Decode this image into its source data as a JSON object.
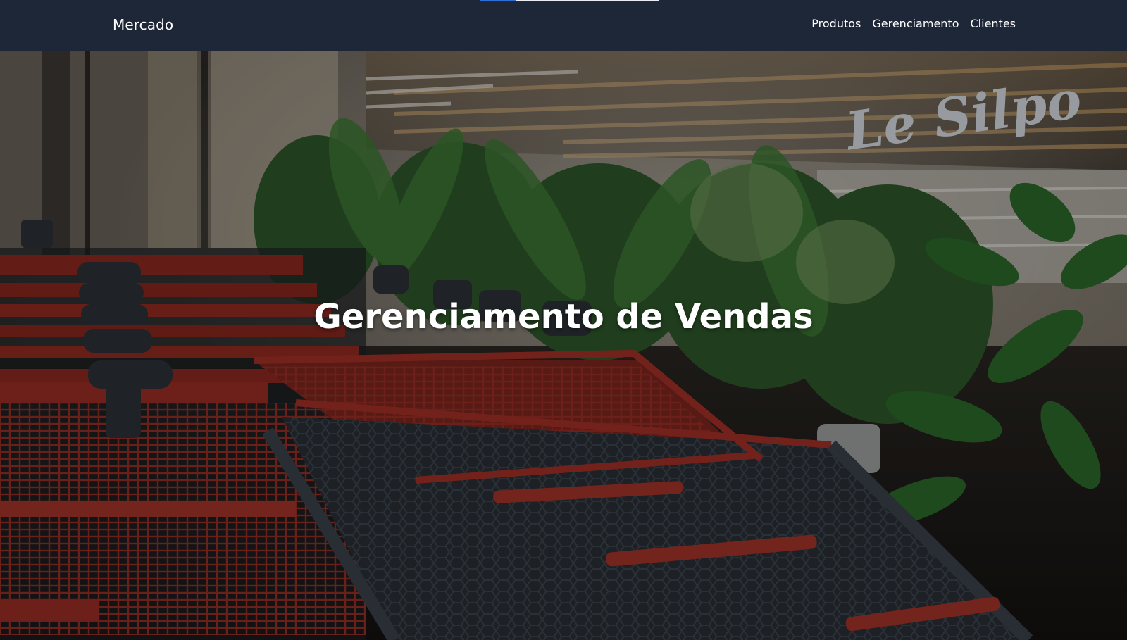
{
  "navbar": {
    "brand": "Mercado",
    "links": [
      {
        "label": "Produtos"
      },
      {
        "label": "Gerenciamento"
      },
      {
        "label": "Clientes"
      }
    ],
    "background": "#1e2738"
  },
  "hero": {
    "title": "Gerenciamento de Vendas",
    "image_description_icon": "shopping-carts-photo",
    "store_sign_text": "Le Silpo"
  },
  "colors": {
    "nav_bg": "#1e2738",
    "text": "#ffffff",
    "accent_blue": "#2f6fd6",
    "cart_red": "#9c2f24"
  }
}
